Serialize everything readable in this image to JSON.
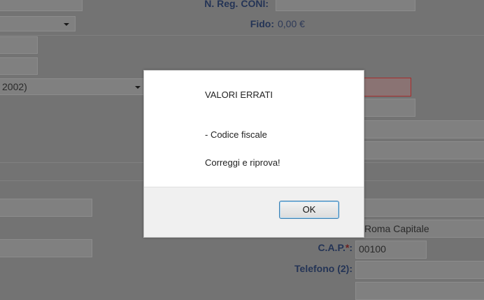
{
  "form": {
    "reg_coni_label": "N. Reg. CONI:",
    "fido_label": "Fido:",
    "fido_value": "0,00 €",
    "select_partial_value": "2002)",
    "comune_value": "Roma Capitale",
    "cap_label": "C.A.P.",
    "cap_required": "*",
    "cap_colon": ":",
    "cap_value": "00100",
    "telefono2_label": "Telefono (2):"
  },
  "dialog": {
    "title": "VALORI ERRATI",
    "error_item": "- Codice fiscale",
    "instruction": "Correggi e riprova!",
    "ok_label": "OK"
  },
  "colors": {
    "overlay": "#737373",
    "error_border": "#a52d2d",
    "ok_button_border": "#3c7fb1"
  }
}
